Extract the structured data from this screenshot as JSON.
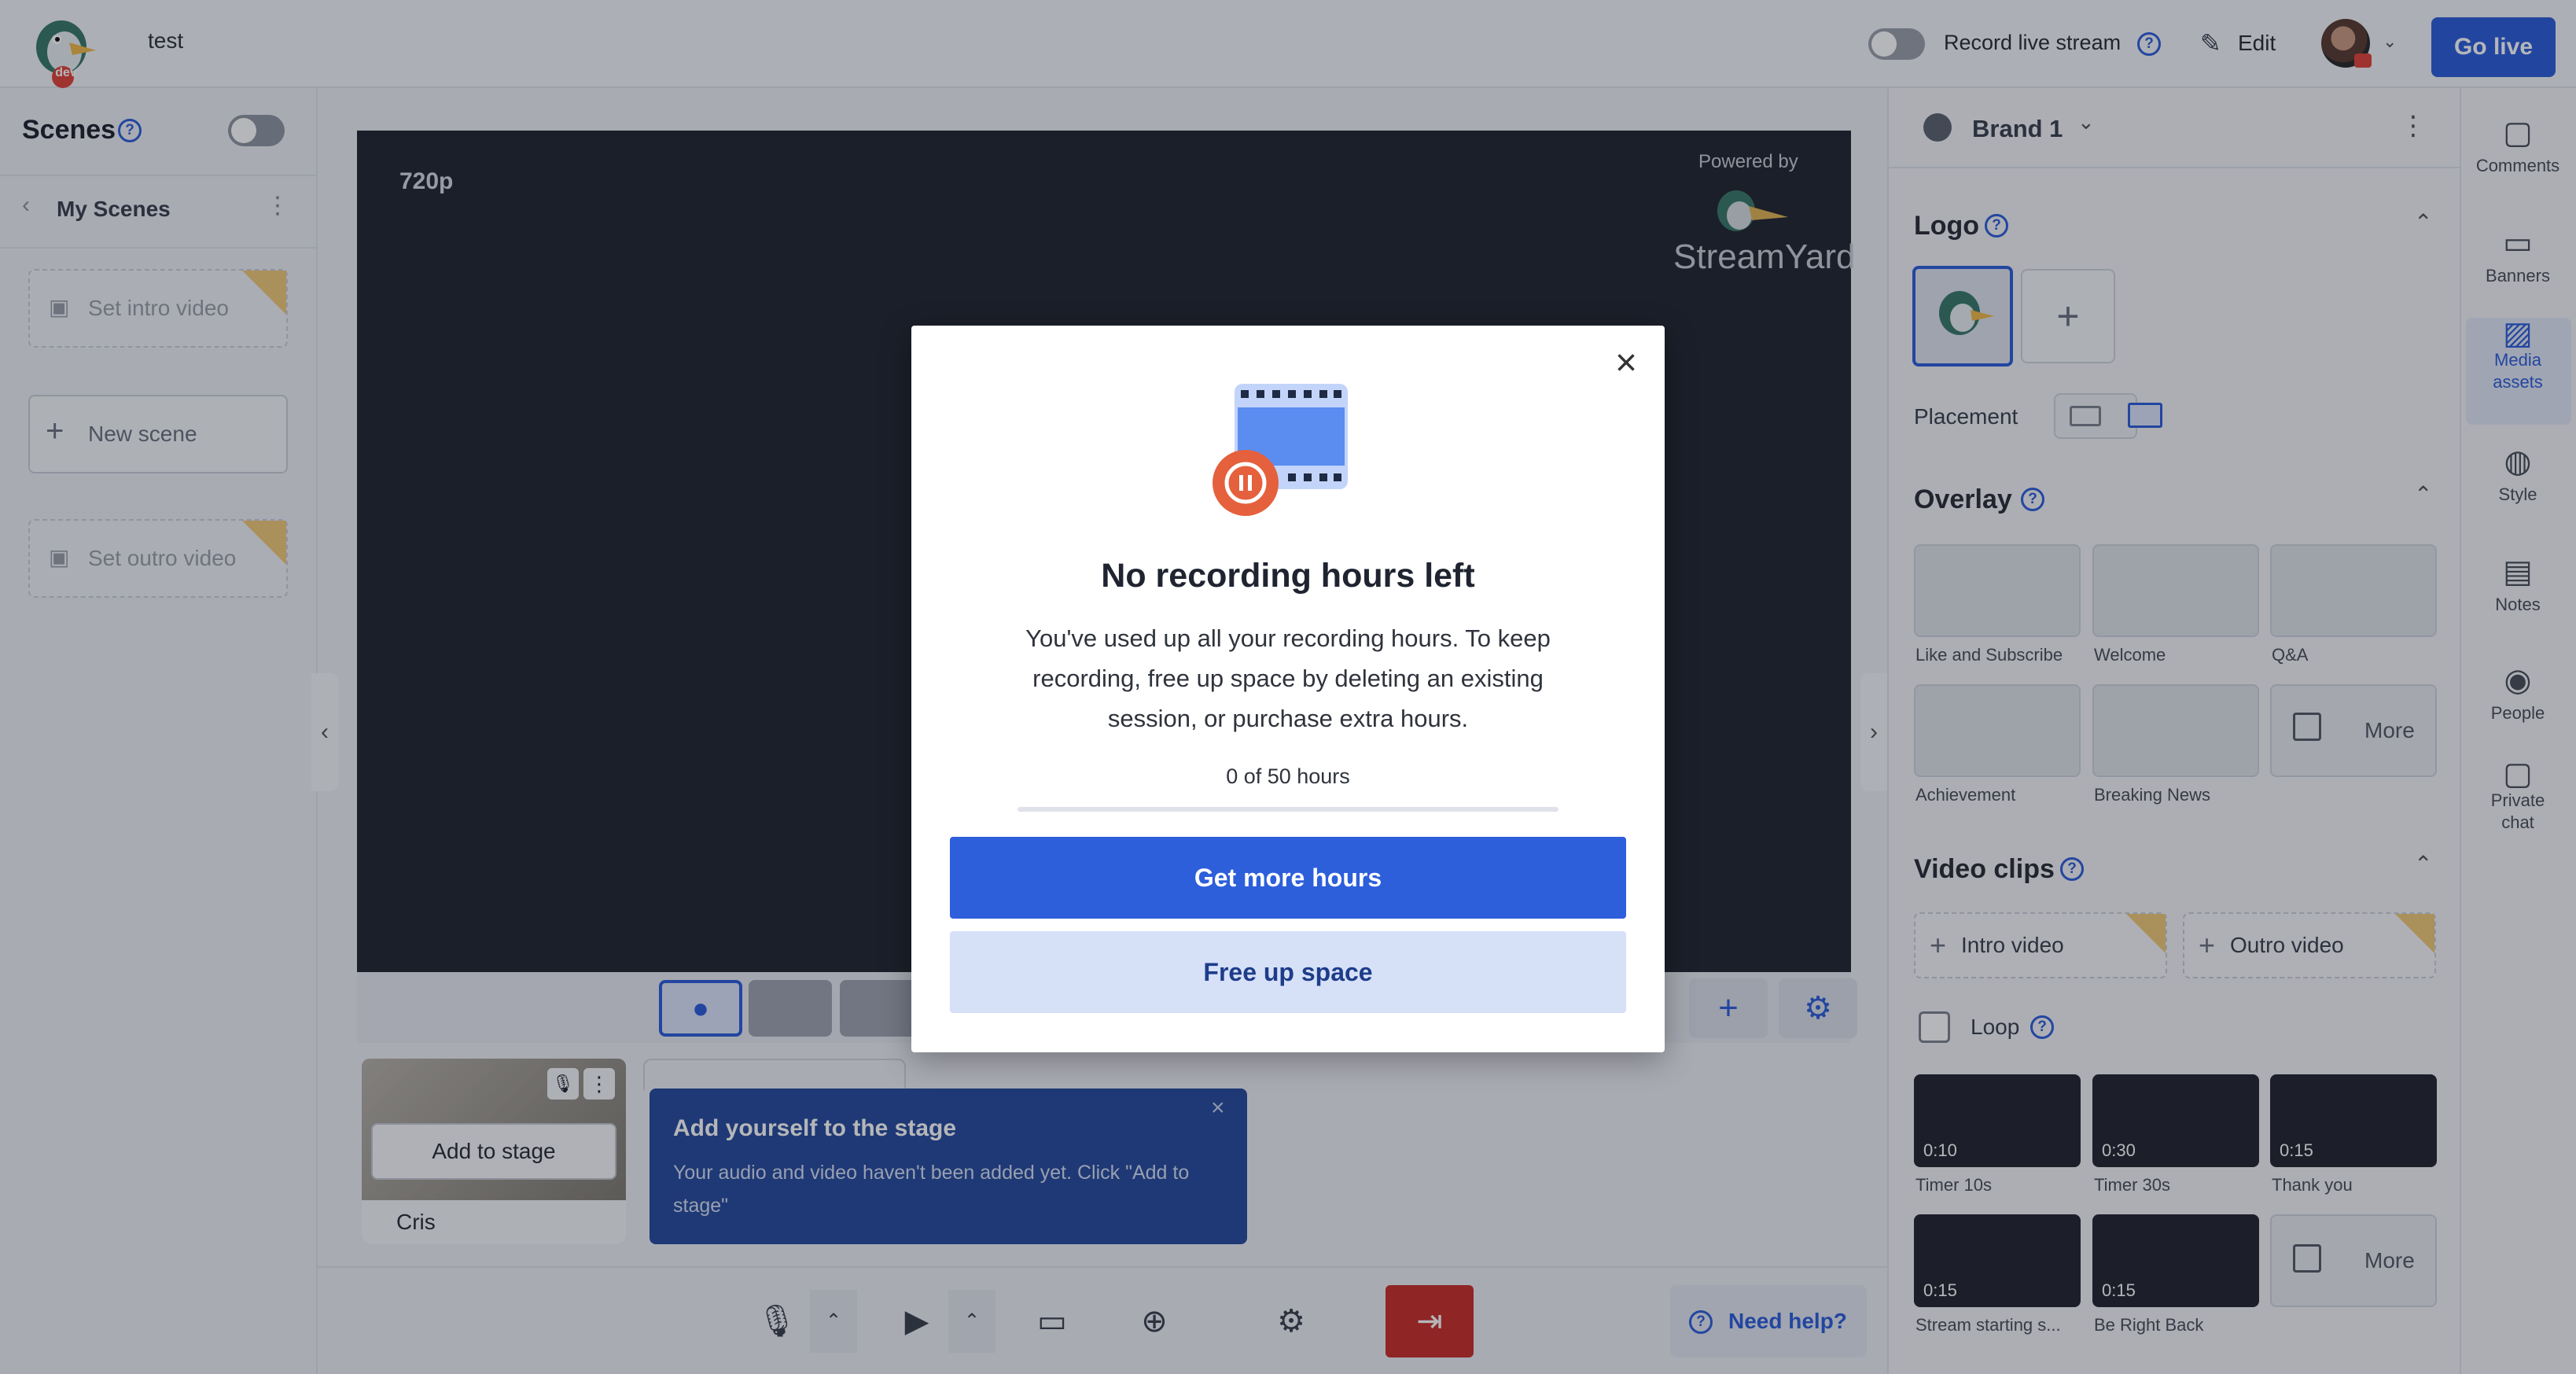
{
  "header": {
    "project_name": "test",
    "record_label": "Record live stream",
    "edit_label": "Edit",
    "go_live_label": "Go live",
    "badge": "dev"
  },
  "scenes": {
    "title": "Scenes",
    "folder": "My Scenes",
    "items": [
      {
        "label": "Set intro video"
      },
      {
        "label": "New scene"
      },
      {
        "label": "Set outro video"
      }
    ]
  },
  "stage": {
    "resolution": "720p",
    "powered_by": "Powered by",
    "brand_text": "StreamYard"
  },
  "guest": {
    "name": "Cris",
    "add_label": "Add to stage"
  },
  "tooltip": {
    "title": "Add yourself to the stage",
    "body": "Your audio and video haven't been added yet. Click \"Add to stage\""
  },
  "bottom": {
    "need_help": "Need help?"
  },
  "brand_panel": {
    "brand_name": "Brand 1",
    "logo_title": "Logo",
    "placement_label": "Placement",
    "overlay_title": "Overlay",
    "overlays": [
      "Like and Subscribe",
      "Welcome",
      "Q&A",
      "Achievement",
      "Breaking News"
    ],
    "more_label": "More",
    "video_clips_title": "Video clips",
    "intro_label": "Intro video",
    "outro_label": "Outro video",
    "loop_label": "Loop",
    "clips": [
      {
        "name": "Timer 10s",
        "duration": "0:10"
      },
      {
        "name": "Timer 30s",
        "duration": "0:30"
      },
      {
        "name": "Thank you",
        "duration": "0:15"
      },
      {
        "name": "Stream starting s...",
        "duration": "0:15"
      },
      {
        "name": "Be Right Back",
        "duration": "0:15"
      }
    ]
  },
  "rail": [
    {
      "label": "Comments"
    },
    {
      "label": "Banners"
    },
    {
      "label": "Media\nassets"
    },
    {
      "label": "Style"
    },
    {
      "label": "Notes"
    },
    {
      "label": "People"
    },
    {
      "label": "Private\nchat"
    }
  ],
  "modal": {
    "title": "No recording hours left",
    "body": "You've used up all your recording hours. To keep recording, free up space by deleting an existing session, or purchase extra hours.",
    "hours_text": "0 of 50 hours",
    "hours_used_fraction": 0,
    "primary_label": "Get more hours",
    "secondary_label": "Free up space"
  },
  "colors": {
    "accent": "#2d5fdb",
    "stage_bg": "#232732",
    "tooltip_bg": "#274c9e",
    "leave_red": "#c9302c"
  }
}
